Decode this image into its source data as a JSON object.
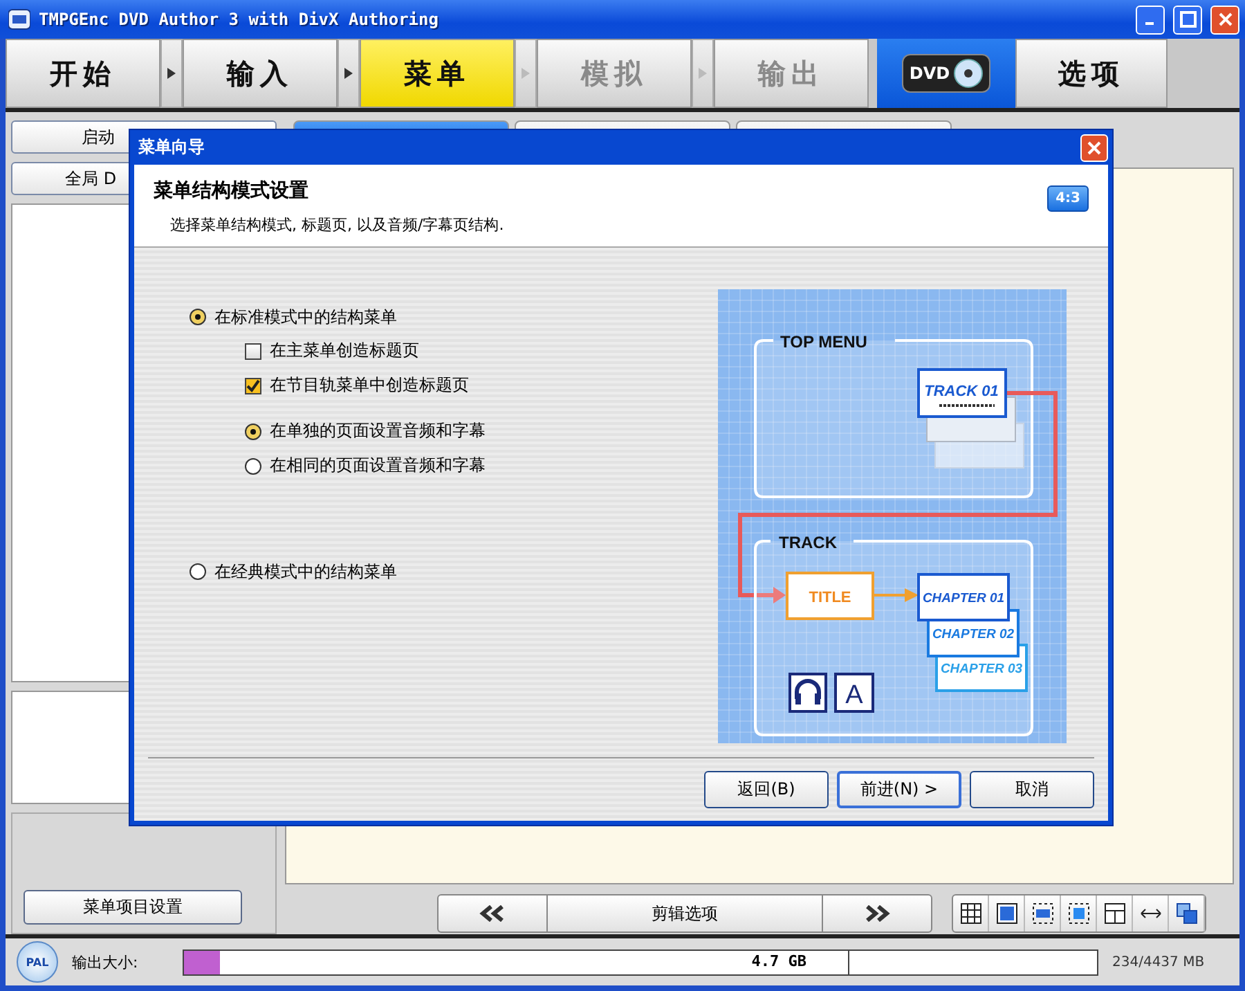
{
  "window": {
    "title": "TMPGEnc DVD Author 3 with DivX Authoring"
  },
  "steps": [
    {
      "label": "开始",
      "selected": false,
      "disabled": false
    },
    {
      "label": "输入",
      "selected": false,
      "disabled": false
    },
    {
      "label": "菜单",
      "selected": true,
      "disabled": false
    },
    {
      "label": "模拟",
      "selected": false,
      "disabled": true
    },
    {
      "label": "输出",
      "selected": false,
      "disabled": true
    }
  ],
  "logo": {
    "label": "DVD"
  },
  "options_button": "选项",
  "left_panel": {
    "buttons": [
      "启动",
      "全局 D"
    ],
    "settings_button": "菜单项目设置"
  },
  "tabs": [
    {
      "selected": true
    },
    {
      "selected": false
    },
    {
      "selected": false
    }
  ],
  "clip_nav": {
    "label": "剪辑选项"
  },
  "status_bar": {
    "format": "PAL",
    "label": "输出大小:",
    "level": 0.04,
    "capacity": "4.7 GB",
    "usage": "234/4437 MB"
  },
  "dialog": {
    "title": "菜单向导",
    "heading": "菜单结构模式设置",
    "subtitle": "选择菜单结构模式, 标题页, 以及音频/字幕页结构.",
    "aspect": "4:3",
    "options": [
      {
        "kind": "radio",
        "label": "在标准模式中的结构菜单",
        "selected": true,
        "children": [
          {
            "kind": "checkbox",
            "label": "在主菜单创造标题页",
            "checked": false
          },
          {
            "kind": "checkbox",
            "label": "在节目轨菜单中创造标题页",
            "checked": true
          },
          {
            "kind": "radio",
            "label": "在单独的页面设置音频和字幕",
            "selected": true
          },
          {
            "kind": "radio",
            "label": "在相同的页面设置音频和字幕",
            "selected": false
          }
        ]
      },
      {
        "kind": "radio",
        "label": "在经典模式中的结构菜单",
        "selected": false
      }
    ],
    "diagram": {
      "top_label": "TOP MENU",
      "track_card": "TRACK 01",
      "track_label": "TRACK",
      "title_card": "TITLE",
      "chapters": [
        "CHAPTER 01",
        "CHAPTER 02",
        "CHAPTER 03"
      ],
      "subtitle_key": "A"
    },
    "buttons": [
      {
        "label": "返回(B)",
        "default": false
      },
      {
        "label": "前进(N) >",
        "default": true
      },
      {
        "label": "取消",
        "default": false
      }
    ]
  }
}
